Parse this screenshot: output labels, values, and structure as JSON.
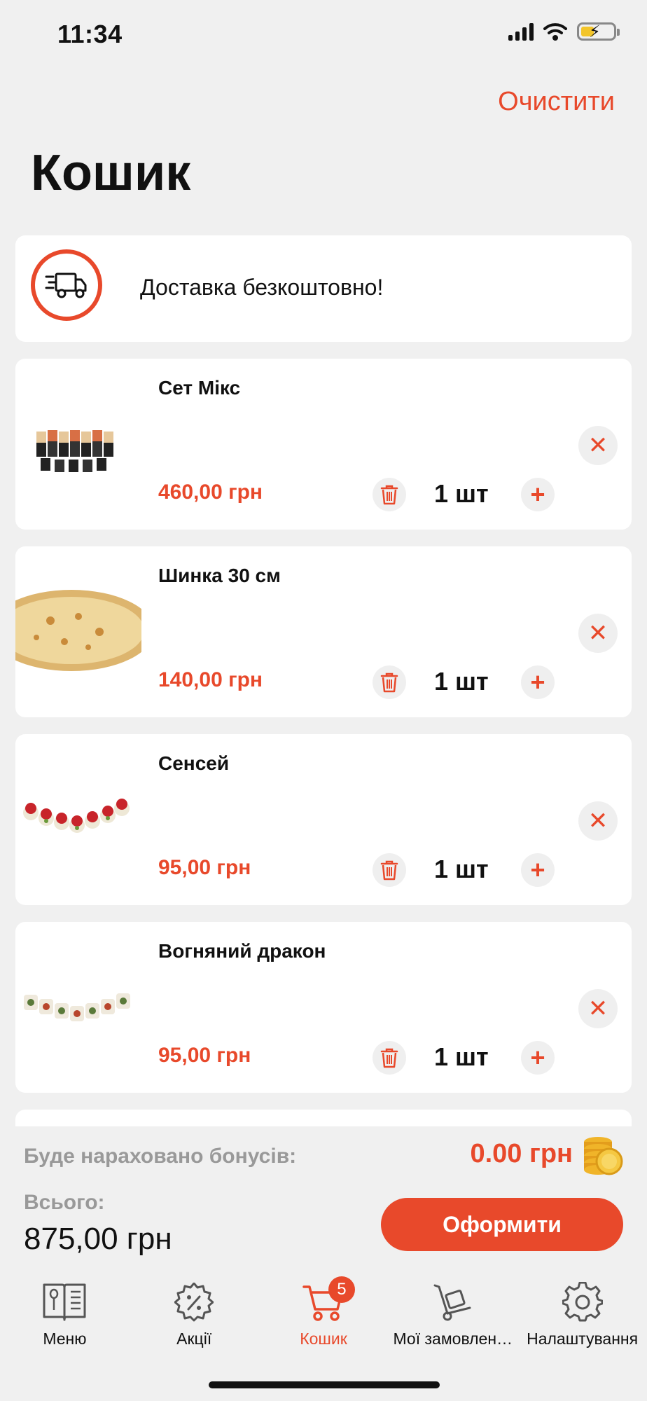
{
  "status_bar": {
    "time": "11:34"
  },
  "header": {
    "clear_label": "Очистити",
    "title": "Кошик"
  },
  "delivery": {
    "text": "Доставка безкоштовно!"
  },
  "items": [
    {
      "name": "Сет Мікс",
      "price": "460,00 грн",
      "qty": "1 шт"
    },
    {
      "name": "Шинка 30 см",
      "price": "140,00 грн",
      "qty": "1 шт"
    },
    {
      "name": "Сенсей",
      "price": "95,00 грн",
      "qty": "1 шт"
    },
    {
      "name": "Вогняний дракон",
      "price": "95,00 грн",
      "qty": "1 шт"
    }
  ],
  "summary": {
    "bonus_label": "Буде нараховано бонусів:",
    "bonus_value": "0.00 грн",
    "total_label": "Всього:",
    "total_value": "875,00 грн",
    "checkout_label": "Оформити"
  },
  "tabbar": {
    "tabs": [
      {
        "label": "Меню",
        "icon": "menu-book-icon"
      },
      {
        "label": "Акції",
        "icon": "discount-gear-icon"
      },
      {
        "label": "Кошик",
        "icon": "cart-icon",
        "badge": "5",
        "active": true
      },
      {
        "label": "Мої замовлен…",
        "icon": "hand-truck-icon"
      },
      {
        "label": "Налаштування",
        "icon": "gear-icon"
      }
    ]
  },
  "colors": {
    "accent": "#e8492b",
    "background": "#f0f0f0",
    "muted_text": "#999999"
  }
}
